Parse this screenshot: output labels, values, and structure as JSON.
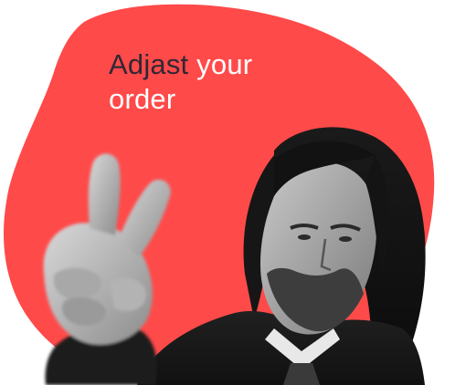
{
  "headline": {
    "line1_part_dark": "Adjast",
    "line1_part_light": " your",
    "line2": "order"
  },
  "colors": {
    "blob": "#ff4a4a",
    "headline_dark": "#2f2834",
    "headline_light": "#ffffff",
    "background": "#ffffff"
  },
  "image": {
    "subject": "bearded man in dark suit making a peace sign",
    "icon": "peace-sign-hand"
  }
}
